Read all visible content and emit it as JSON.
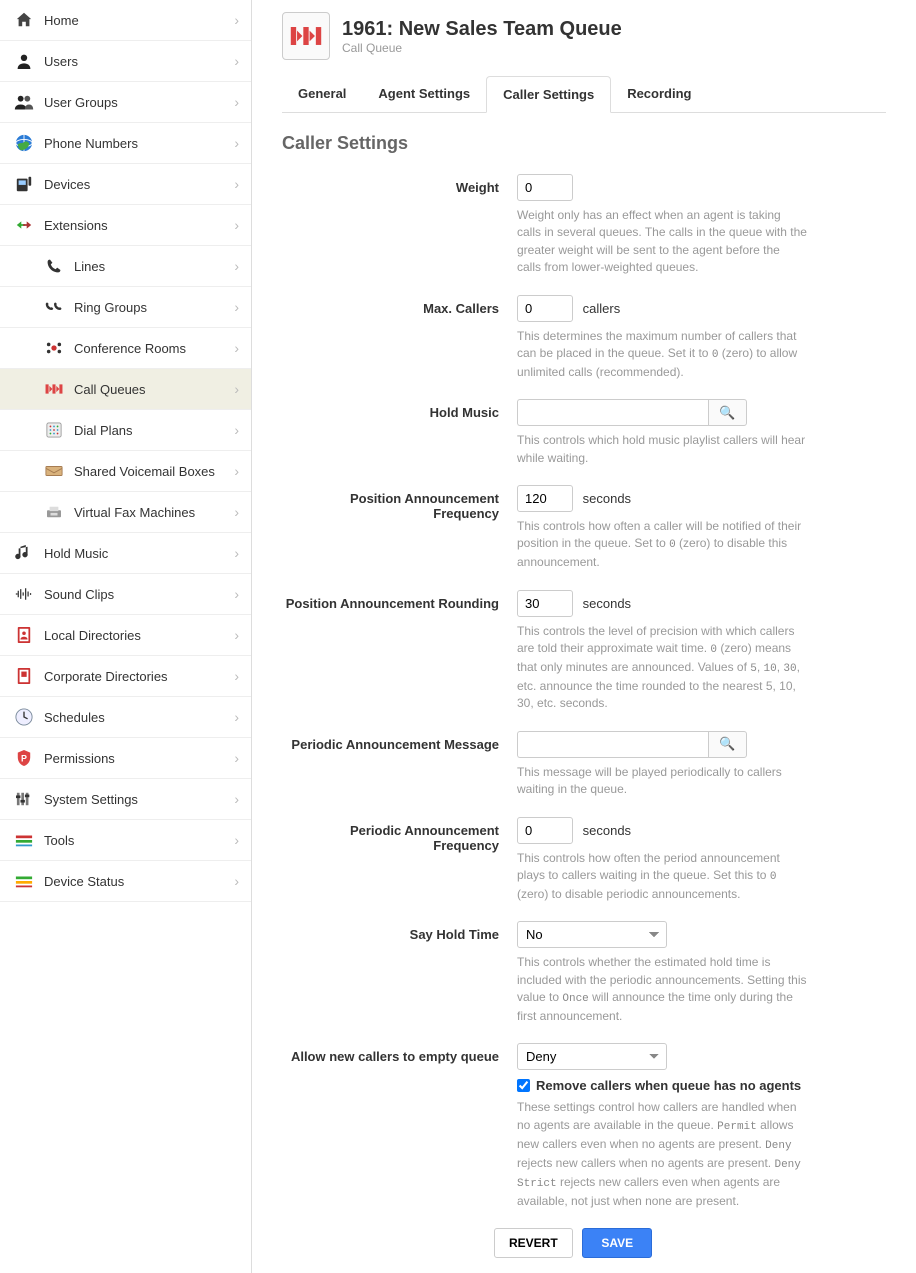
{
  "sidebar": {
    "items": [
      {
        "label": "Home",
        "icon": "home"
      },
      {
        "label": "Users",
        "icon": "user"
      },
      {
        "label": "User Groups",
        "icon": "group"
      },
      {
        "label": "Phone Numbers",
        "icon": "globe"
      },
      {
        "label": "Devices",
        "icon": "device"
      },
      {
        "label": "Extensions",
        "icon": "arrows"
      },
      {
        "label": "Lines",
        "icon": "phone",
        "sub": true
      },
      {
        "label": "Ring Groups",
        "icon": "ringgroup",
        "sub": true
      },
      {
        "label": "Conference Rooms",
        "icon": "conf",
        "sub": true
      },
      {
        "label": "Call Queues",
        "icon": "queue",
        "sub": true,
        "active": true
      },
      {
        "label": "Dial Plans",
        "icon": "dial",
        "sub": true
      },
      {
        "label": "Shared Voicemail Boxes",
        "icon": "vm",
        "sub": true
      },
      {
        "label": "Virtual Fax Machines",
        "icon": "fax",
        "sub": true
      },
      {
        "label": "Hold Music",
        "icon": "music"
      },
      {
        "label": "Sound Clips",
        "icon": "sound"
      },
      {
        "label": "Local Directories",
        "icon": "localdir"
      },
      {
        "label": "Corporate Directories",
        "icon": "corpdir"
      },
      {
        "label": "Schedules",
        "icon": "clock"
      },
      {
        "label": "Permissions",
        "icon": "perm"
      },
      {
        "label": "System Settings",
        "icon": "settings"
      },
      {
        "label": "Tools",
        "icon": "tools"
      },
      {
        "label": "Device Status",
        "icon": "status"
      }
    ]
  },
  "header": {
    "title": "1961: New Sales Team Queue",
    "subtitle": "Call Queue"
  },
  "tabs": [
    {
      "label": "General"
    },
    {
      "label": "Agent Settings"
    },
    {
      "label": "Caller Settings",
      "active": true
    },
    {
      "label": "Recording"
    }
  ],
  "section_title": "Caller Settings",
  "fields": {
    "weight": {
      "label": "Weight",
      "value": "0",
      "help": "Weight only has an effect when an agent is taking calls in several queues. The calls in the queue with the greater weight will be sent to the agent before the calls from lower-weighted queues."
    },
    "max_callers": {
      "label": "Max. Callers",
      "value": "0",
      "unit": "callers",
      "help_pre": "This determines the maximum number of callers that can be placed in the queue. Set it to ",
      "help_code": "0",
      "help_post": " (zero) to allow unlimited calls (recommended)."
    },
    "hold_music": {
      "label": "Hold Music",
      "value": "",
      "help": "This controls which hold music playlist callers will hear while waiting."
    },
    "pos_ann_freq": {
      "label": "Position Announcement Frequency",
      "value": "120",
      "unit": "seconds",
      "help_pre": "This controls how often a caller will be notified of their position in the queue. Set to ",
      "help_code": "0",
      "help_post": " (zero) to disable this announcement."
    },
    "pos_ann_round": {
      "label": "Position Announcement Rounding",
      "value": "30",
      "unit": "seconds",
      "help_pre": "This controls the level of precision with which callers are told their approximate wait time. ",
      "help_code1": "0",
      "help_mid": " (zero) means that only minutes are announced. Values of ",
      "help_code2": "5",
      "help_sep1": ", ",
      "help_code3": "10",
      "help_sep2": ", ",
      "help_code4": "30",
      "help_post": ", etc. announce the time rounded to the nearest 5, 10, 30, etc. seconds."
    },
    "periodic_msg": {
      "label": "Periodic Announcement Message",
      "value": "",
      "help": "This message will be played periodically to callers waiting in the queue."
    },
    "periodic_freq": {
      "label": "Periodic Announcement Frequency",
      "value": "0",
      "unit": "seconds",
      "help_pre": "This controls how often the period announcement plays to callers waiting in the queue. Set this to ",
      "help_code": "0",
      "help_post": " (zero) to disable periodic announcements."
    },
    "say_hold": {
      "label": "Say Hold Time",
      "value": "No",
      "help_pre": "This controls whether the estimated hold time is included with the periodic announcements. Setting this value to ",
      "help_code": "Once",
      "help_post": " will announce the time only during the first announcement."
    },
    "allow_empty": {
      "label": "Allow new callers to empty queue",
      "value": "Deny",
      "checkbox_label": "Remove callers when queue has no agents",
      "checkbox_checked": true,
      "help_pre": "These settings control how callers are handled when no agents are available in the queue. ",
      "help_code1": "Permit",
      "help_mid1": " allows new callers even when no agents are present. ",
      "help_code2": "Deny",
      "help_mid2": " rejects new callers when no agents are present. ",
      "help_code3": "Deny Strict",
      "help_post": " rejects new callers even when agents are available, not just when none are present."
    }
  },
  "buttons": {
    "revert": "REVERT",
    "save": "SAVE"
  }
}
